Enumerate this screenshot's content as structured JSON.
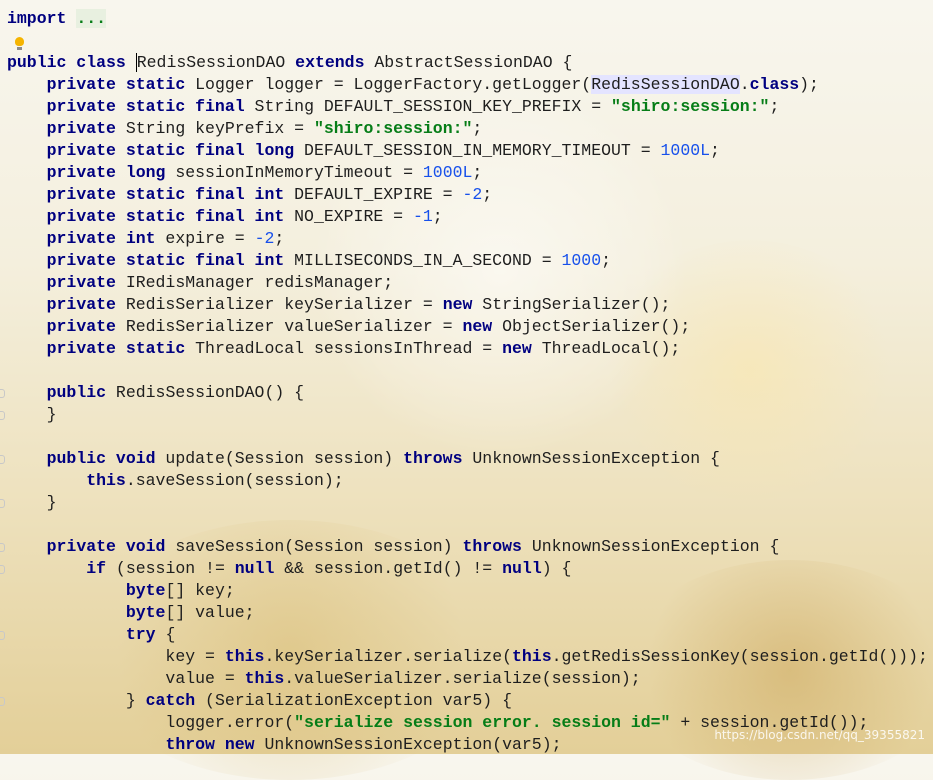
{
  "editor": {
    "lines": [
      [
        {
          "t": "import",
          "c": "kw"
        },
        {
          "t": " "
        },
        {
          "t": "...",
          "c": "dots"
        }
      ],
      [],
      [
        {
          "t": "public class",
          "c": "kw"
        },
        {
          "t": " "
        },
        {
          "t": "RedisSessionDAO",
          "c": "caret"
        },
        {
          "t": " "
        },
        {
          "t": "extends",
          "c": "kw"
        },
        {
          "t": " AbstractSessionDAO {"
        }
      ],
      [
        {
          "t": "    "
        },
        {
          "t": "private static",
          "c": "kw"
        },
        {
          "t": " Logger logger = LoggerFactory.getLogger("
        },
        {
          "t": "RedisSessionDAO",
          "c": "ref"
        },
        {
          "t": "."
        },
        {
          "t": "class",
          "c": "kw"
        },
        {
          "t": ");"
        }
      ],
      [
        {
          "t": "    "
        },
        {
          "t": "private static final",
          "c": "kw"
        },
        {
          "t": " String DEFAULT_SESSION_KEY_PREFIX = "
        },
        {
          "t": "\"shiro:session:\"",
          "c": "str"
        },
        {
          "t": ";"
        }
      ],
      [
        {
          "t": "    "
        },
        {
          "t": "private",
          "c": "kw"
        },
        {
          "t": " String keyPrefix = "
        },
        {
          "t": "\"shiro:session:\"",
          "c": "str"
        },
        {
          "t": ";"
        }
      ],
      [
        {
          "t": "    "
        },
        {
          "t": "private static final long",
          "c": "kw"
        },
        {
          "t": " DEFAULT_SESSION_IN_MEMORY_TIMEOUT = "
        },
        {
          "t": "1000L",
          "c": "num"
        },
        {
          "t": ";"
        }
      ],
      [
        {
          "t": "    "
        },
        {
          "t": "private long",
          "c": "kw"
        },
        {
          "t": " sessionInMemoryTimeout = "
        },
        {
          "t": "1000L",
          "c": "num"
        },
        {
          "t": ";"
        }
      ],
      [
        {
          "t": "    "
        },
        {
          "t": "private static final int",
          "c": "kw"
        },
        {
          "t": " DEFAULT_EXPIRE = "
        },
        {
          "t": "-2",
          "c": "num"
        },
        {
          "t": ";"
        }
      ],
      [
        {
          "t": "    "
        },
        {
          "t": "private static final int",
          "c": "kw"
        },
        {
          "t": " NO_EXPIRE = "
        },
        {
          "t": "-1",
          "c": "num"
        },
        {
          "t": ";"
        }
      ],
      [
        {
          "t": "    "
        },
        {
          "t": "private int",
          "c": "kw"
        },
        {
          "t": " expire = "
        },
        {
          "t": "-2",
          "c": "num"
        },
        {
          "t": ";"
        }
      ],
      [
        {
          "t": "    "
        },
        {
          "t": "private static final int",
          "c": "kw"
        },
        {
          "t": " MILLISECONDS_IN_A_SECOND = "
        },
        {
          "t": "1000",
          "c": "num"
        },
        {
          "t": ";"
        }
      ],
      [
        {
          "t": "    "
        },
        {
          "t": "private",
          "c": "kw"
        },
        {
          "t": " IRedisManager redisManager;"
        }
      ],
      [
        {
          "t": "    "
        },
        {
          "t": "private",
          "c": "kw"
        },
        {
          "t": " RedisSerializer keySerializer = "
        },
        {
          "t": "new",
          "c": "kw"
        },
        {
          "t": " StringSerializer();"
        }
      ],
      [
        {
          "t": "    "
        },
        {
          "t": "private",
          "c": "kw"
        },
        {
          "t": " RedisSerializer valueSerializer = "
        },
        {
          "t": "new",
          "c": "kw"
        },
        {
          "t": " ObjectSerializer();"
        }
      ],
      [
        {
          "t": "    "
        },
        {
          "t": "private static",
          "c": "kw"
        },
        {
          "t": " ThreadLocal sessionsInThread = "
        },
        {
          "t": "new",
          "c": "kw"
        },
        {
          "t": " ThreadLocal();"
        }
      ],
      [],
      [
        {
          "t": "    "
        },
        {
          "t": "public",
          "c": "kw"
        },
        {
          "t": " RedisSessionDAO() {"
        }
      ],
      [
        {
          "t": "    }"
        }
      ],
      [],
      [
        {
          "t": "    "
        },
        {
          "t": "public void",
          "c": "kw"
        },
        {
          "t": " update(Session session) "
        },
        {
          "t": "throws",
          "c": "kw"
        },
        {
          "t": " UnknownSessionException {"
        }
      ],
      [
        {
          "t": "        "
        },
        {
          "t": "this",
          "c": "kw"
        },
        {
          "t": ".saveSession(session);"
        }
      ],
      [
        {
          "t": "    }"
        }
      ],
      [],
      [
        {
          "t": "    "
        },
        {
          "t": "private void",
          "c": "kw"
        },
        {
          "t": " saveSession(Session session) "
        },
        {
          "t": "throws",
          "c": "kw"
        },
        {
          "t": " UnknownSessionException {"
        }
      ],
      [
        {
          "t": "        "
        },
        {
          "t": "if",
          "c": "kw"
        },
        {
          "t": " (session != "
        },
        {
          "t": "null",
          "c": "kw"
        },
        {
          "t": " && session.getId() != "
        },
        {
          "t": "null",
          "c": "kw"
        },
        {
          "t": ") {"
        }
      ],
      [
        {
          "t": "            "
        },
        {
          "t": "byte",
          "c": "kw"
        },
        {
          "t": "[] key;"
        }
      ],
      [
        {
          "t": "            "
        },
        {
          "t": "byte",
          "c": "kw"
        },
        {
          "t": "[] value;"
        }
      ],
      [
        {
          "t": "            "
        },
        {
          "t": "try",
          "c": "kw"
        },
        {
          "t": " {"
        }
      ],
      [
        {
          "t": "                key = "
        },
        {
          "t": "this",
          "c": "kw"
        },
        {
          "t": ".keySerializer.serialize("
        },
        {
          "t": "this",
          "c": "kw"
        },
        {
          "t": ".getRedisSessionKey(session.getId()));"
        }
      ],
      [
        {
          "t": "                value = "
        },
        {
          "t": "this",
          "c": "kw"
        },
        {
          "t": ".valueSerializer.serialize(session);"
        }
      ],
      [
        {
          "t": "            } "
        },
        {
          "t": "catch",
          "c": "kw"
        },
        {
          "t": " (SerializationException var5) {"
        }
      ],
      [
        {
          "t": "                logger.error("
        },
        {
          "t": "\"serialize session error. session id=\"",
          "c": "str"
        },
        {
          "t": " + session.getId());"
        }
      ],
      [
        {
          "t": "                "
        },
        {
          "t": "throw new",
          "c": "kw"
        },
        {
          "t": " UnknownSessionException(var5);"
        }
      ]
    ]
  },
  "watermark": "https://blog.csdn.net/qq_39355821",
  "icons": {
    "intention": "lightbulb-icon",
    "fold": "fold-marker-icon"
  },
  "colors": {
    "keyword": "#000080",
    "string": "#067d17",
    "number": "#1750eb",
    "text": "#1e1e1e"
  }
}
